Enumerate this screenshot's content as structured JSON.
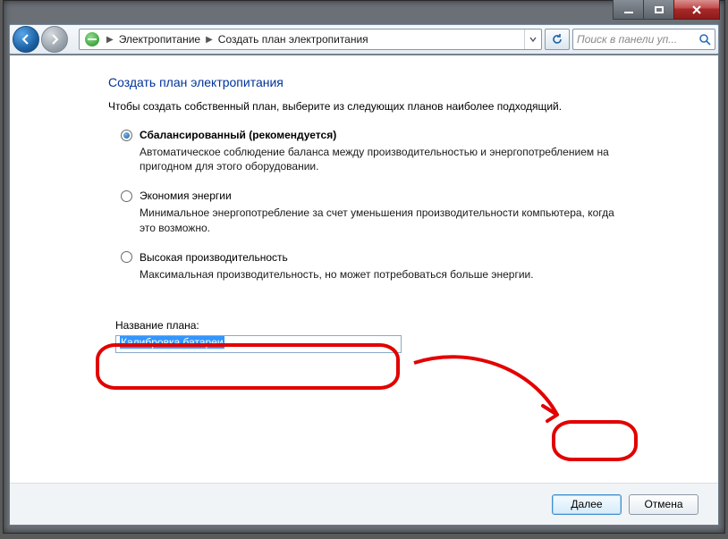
{
  "titlebar": {
    "minimize": "Minimize",
    "maximize": "Maximize",
    "close": "Close"
  },
  "nav": {
    "back": "Back",
    "forward": "Forward",
    "crumb1": "Электропитание",
    "crumb2": "Создать план электропитания",
    "refresh": "Refresh",
    "search_placeholder": "Поиск в панели уп...",
    "search_go": "Search"
  },
  "page": {
    "heading": "Создать план электропитания",
    "intro": "Чтобы создать собственный план, выберите из следующих планов наиболее подходящий."
  },
  "plans": [
    {
      "title": "Сбалансированный (рекомендуется)",
      "desc": "Автоматическое соблюдение баланса между производительностью и энергопотреблением на пригодном для этого оборудовании.",
      "checked": true
    },
    {
      "title": "Экономия энергии",
      "desc": "Минимальное энергопотребление за счет уменьшения производительности компьютера, когда это возможно.",
      "checked": false
    },
    {
      "title": "Высокая производительность",
      "desc": "Максимальная производительность, но может потребоваться больше энергии.",
      "checked": false
    }
  ],
  "plan_name": {
    "label": "Название плана:",
    "value": "Калибровка батареи"
  },
  "buttons": {
    "next": "Далее",
    "cancel": "Отмена"
  }
}
